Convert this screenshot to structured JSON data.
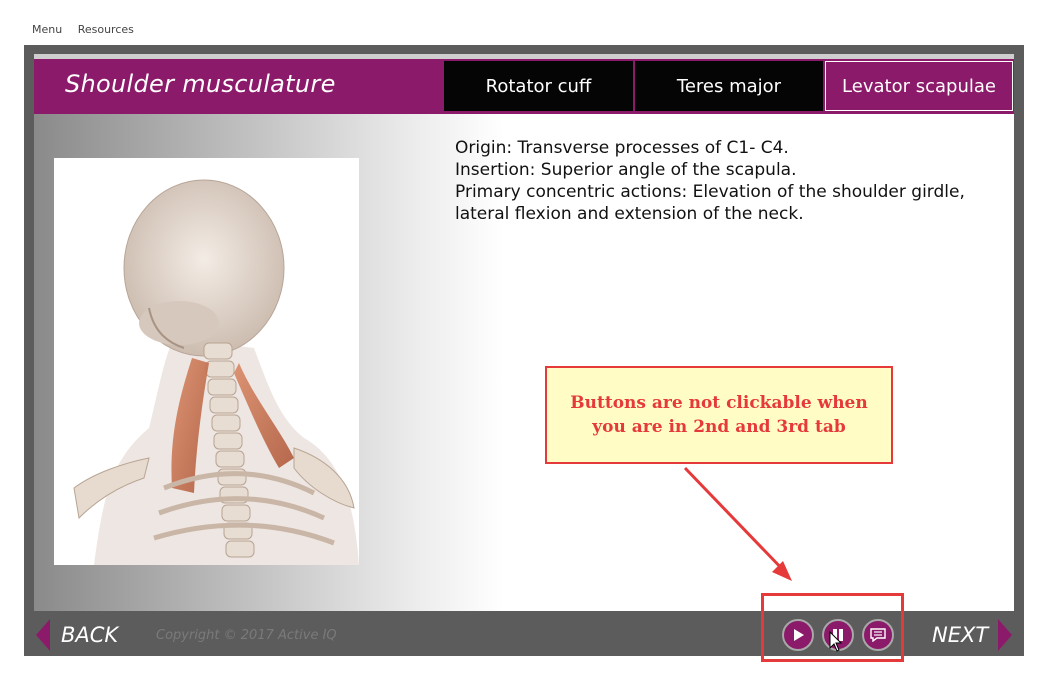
{
  "top_menu": {
    "menu": "Menu",
    "resources": "Resources"
  },
  "header": {
    "title": "Shoulder musculature"
  },
  "tabs": [
    {
      "label": "Rotator cuff",
      "state": "inactive"
    },
    {
      "label": "Teres major",
      "state": "inactive"
    },
    {
      "label": "Levator scapulae",
      "state": "active"
    }
  ],
  "description": {
    "origin": "Origin: Transverse processes of C1- C4.",
    "insertion": "Insertion: Superior angle of the scapula.",
    "actions_line1": "Primary concentric actions: Elevation of the shoulder girdle,",
    "actions_line2": "lateral flexion and extension of the neck."
  },
  "annotation": {
    "note": "Buttons are not clickable when you are in 2nd and 3rd tab"
  },
  "footer": {
    "back": "BACK",
    "next": "NEXT",
    "copyright": "Copyright © 2017 Active IQ"
  },
  "controls": {
    "play": "play-icon",
    "pause": "pause-icon",
    "transcript": "transcript-icon"
  },
  "colors": {
    "brand": "#8c1a6a",
    "annotation_red": "#e5393a",
    "note_bg": "#fffcc6",
    "frame": "#5c5c5c"
  },
  "icons": {
    "image": "neck-skeleton-anatomy-image",
    "cursor": "mouse-pointer-icon"
  }
}
